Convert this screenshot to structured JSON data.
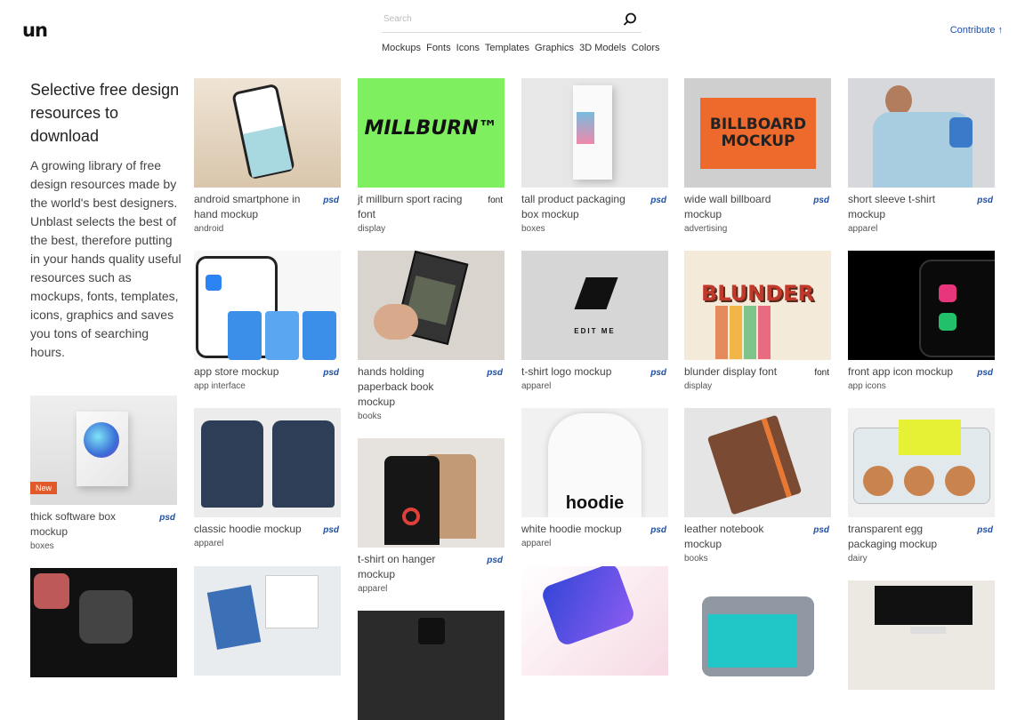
{
  "header": {
    "logo": "un",
    "search_placeholder": "Search",
    "nav": [
      "Mockups",
      "Fonts",
      "Icons",
      "Templates",
      "Graphics",
      "3D Models",
      "Colors"
    ],
    "contribute": "Contribute ↑"
  },
  "intro": {
    "heading": "Selective free design resources to download",
    "body": "A growing library of free design resources made by the world's best designers. Unblast selects the best of the best, therefore putting in your hands quality useful resources such as mockups, fonts, templates, icons, graphics and saves you tons of searching hours."
  },
  "cards": {
    "c1": {
      "title": "android smartphone in hand mockup",
      "tag": "android",
      "badge": "psd"
    },
    "c2": {
      "title": "jt millburn sport racing font",
      "tag": "display",
      "badge": "font",
      "thumb_text": "MILLBURN™"
    },
    "c3": {
      "title": "tall product packaging box mockup",
      "tag": "boxes",
      "badge": "psd"
    },
    "c4": {
      "title": "wide wall billboard mockup",
      "tag": "advertising",
      "badge": "psd",
      "thumb_text": "BILLBOARD MOCKUP"
    },
    "c5": {
      "title": "short sleeve t-shirt mockup",
      "tag": "apparel",
      "badge": "psd"
    },
    "c6": {
      "title": "app store mockup",
      "tag": "app interface",
      "badge": "psd"
    },
    "c7": {
      "title": "hands holding paperback book mockup",
      "tag": "books",
      "badge": "psd"
    },
    "c8": {
      "title": "t-shirt logo mockup",
      "tag": "apparel",
      "badge": "psd",
      "thumb_text": "EDIT ME"
    },
    "c9": {
      "title": "blunder display font",
      "tag": "display",
      "badge": "font",
      "thumb_text": "BLUNDER"
    },
    "c10": {
      "title": "front app icon mockup",
      "tag": "app icons",
      "badge": "psd"
    },
    "c11": {
      "title": "thick software box mockup",
      "tag": "boxes",
      "badge": "psd",
      "new": "New"
    },
    "c12": {
      "title": "classic hoodie mockup",
      "tag": "apparel",
      "badge": "psd"
    },
    "c13": {
      "title": "t-shirt on hanger mockup",
      "tag": "apparel",
      "badge": "psd"
    },
    "c14": {
      "title": "white hoodie mockup",
      "tag": "apparel",
      "badge": "psd",
      "thumb_text": "hoodie"
    },
    "c15": {
      "title": "leather notebook mockup",
      "tag": "books",
      "badge": "psd"
    },
    "c16": {
      "title": "transparent egg packaging mockup",
      "tag": "dairy",
      "badge": "psd"
    }
  }
}
